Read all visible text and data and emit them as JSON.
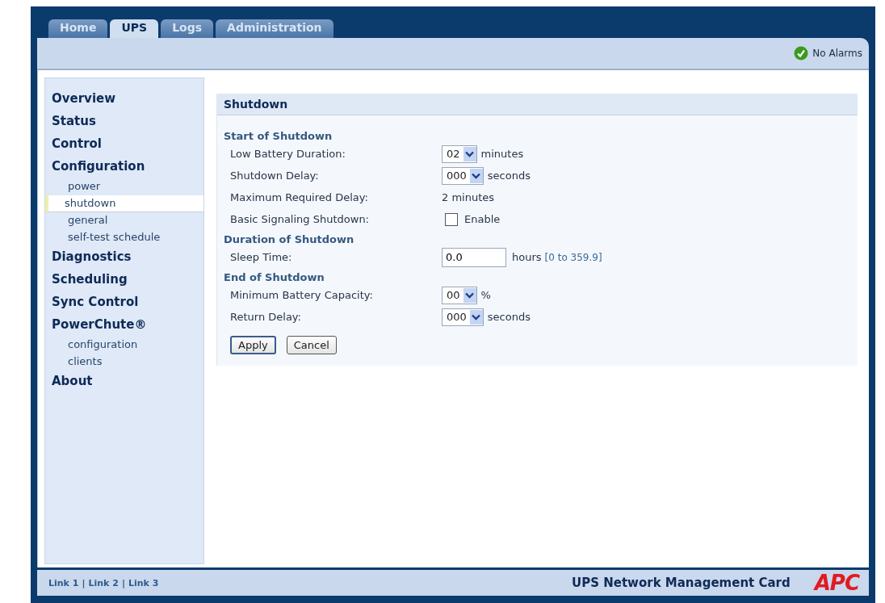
{
  "tabs": [
    {
      "label": "Home",
      "selected": false
    },
    {
      "label": "UPS",
      "selected": true
    },
    {
      "label": "Logs",
      "selected": false
    },
    {
      "label": "Administration",
      "selected": false
    }
  ],
  "alarm_status": {
    "label": "No Alarms",
    "ok": true
  },
  "sidebar": {
    "items": [
      {
        "label": "Overview",
        "selected": false
      },
      {
        "label": "Status",
        "selected": false
      },
      {
        "label": "Control",
        "selected": false
      },
      {
        "label": "Configuration",
        "selected": false,
        "children": [
          {
            "label": "power",
            "selected": false
          },
          {
            "label": "shutdown",
            "selected": true
          },
          {
            "label": "general",
            "selected": false
          },
          {
            "label": "self-test schedule",
            "selected": false
          }
        ]
      },
      {
        "label": "Diagnostics",
        "selected": false
      },
      {
        "label": "Scheduling",
        "selected": false
      },
      {
        "label": "Sync Control",
        "selected": false
      },
      {
        "label": "PowerChute®",
        "selected": false,
        "children": [
          {
            "label": "configuration",
            "selected": false
          },
          {
            "label": "clients",
            "selected": false
          }
        ]
      },
      {
        "label": "About",
        "selected": false
      }
    ]
  },
  "panel": {
    "title": "Shutdown",
    "sections": [
      {
        "heading": "Start of Shutdown",
        "rows": [
          {
            "kind": "select",
            "label": "Low Battery Duration:",
            "value": "02",
            "unit": "minutes"
          },
          {
            "kind": "select",
            "label": "Shutdown Delay:",
            "value": "000",
            "unit": "seconds"
          },
          {
            "kind": "text",
            "label": "Maximum Required Delay:",
            "value": "2 minutes"
          },
          {
            "kind": "checkbox",
            "label": "Basic Signaling Shutdown:",
            "checked": false,
            "unit": "Enable"
          }
        ]
      },
      {
        "heading": "Duration of Shutdown",
        "rows": [
          {
            "kind": "input",
            "label": "Sleep Time:",
            "value": "0.0",
            "unit": "hours",
            "hint": "[0 to 359.9]"
          }
        ]
      },
      {
        "heading": "End of Shutdown",
        "rows": [
          {
            "kind": "select",
            "label": "Minimum Battery Capacity:",
            "value": "00",
            "unit": "%"
          },
          {
            "kind": "select",
            "label": "Return Delay:",
            "value": "000",
            "unit": "seconds"
          }
        ]
      }
    ],
    "buttons": [
      "Apply",
      "Cancel"
    ]
  },
  "footer": {
    "links": [
      "Link 1",
      "Link 2",
      "Link 3"
    ],
    "separator": "|",
    "product": "UPS Network Management Card",
    "logo": "APC"
  }
}
